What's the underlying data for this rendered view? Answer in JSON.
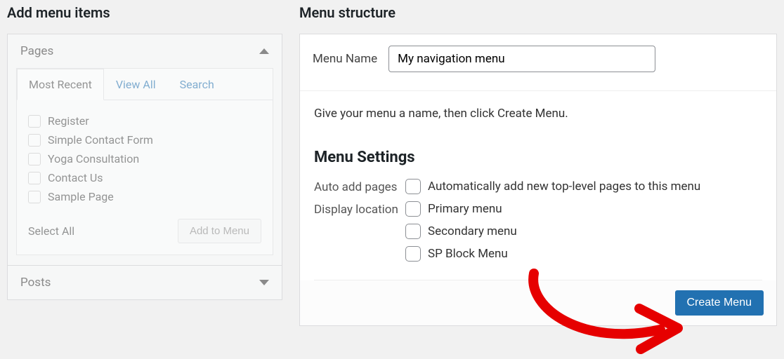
{
  "left": {
    "heading": "Add menu items",
    "panels": {
      "pages": {
        "title": "Pages",
        "open": true
      },
      "posts": {
        "title": "Posts",
        "open": false
      }
    },
    "tabs": {
      "recent": "Most Recent",
      "view_all": "View All",
      "search": "Search"
    },
    "page_items": [
      "Register",
      "Simple Contact Form",
      "Yoga Consultation",
      "Contact Us",
      "Sample Page"
    ],
    "select_all": "Select All",
    "add_to_menu": "Add to Menu"
  },
  "right": {
    "heading": "Menu structure",
    "menu_name_label": "Menu Name",
    "menu_name_value": "My navigation menu",
    "instruction": "Give your menu a name, then click Create Menu.",
    "settings_title": "Menu Settings",
    "auto_add_label": "Auto add pages",
    "auto_add_option": "Automatically add new top-level pages to this menu",
    "display_loc_label": "Display location",
    "locations": [
      "Primary menu",
      "Secondary menu",
      "SP Block Menu"
    ],
    "create_button": "Create Menu"
  }
}
